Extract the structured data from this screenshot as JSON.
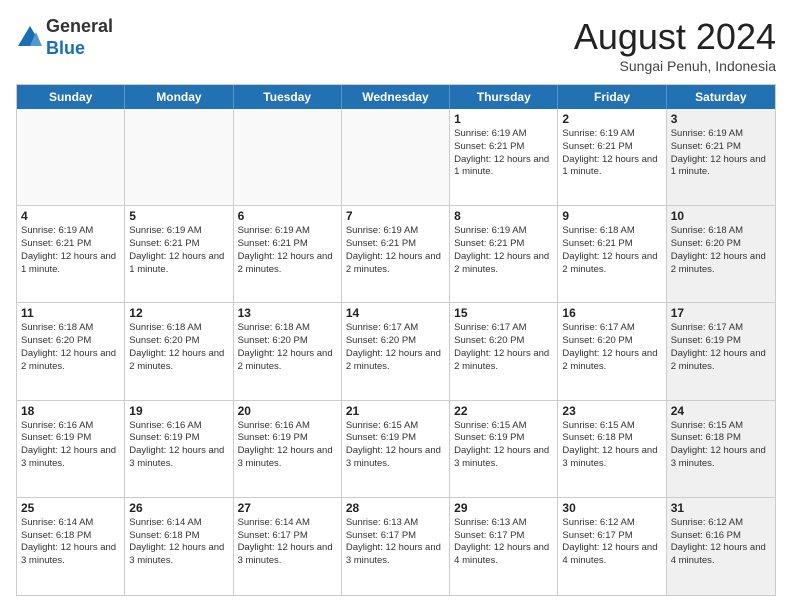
{
  "header": {
    "logo_line1": "General",
    "logo_line2": "Blue",
    "month": "August 2024",
    "location": "Sungai Penuh, Indonesia"
  },
  "weekdays": [
    "Sunday",
    "Monday",
    "Tuesday",
    "Wednesday",
    "Thursday",
    "Friday",
    "Saturday"
  ],
  "rows": [
    [
      {
        "day": "",
        "sunrise": "",
        "sunset": "",
        "daylight": "",
        "empty": true
      },
      {
        "day": "",
        "sunrise": "",
        "sunset": "",
        "daylight": "",
        "empty": true
      },
      {
        "day": "",
        "sunrise": "",
        "sunset": "",
        "daylight": "",
        "empty": true
      },
      {
        "day": "",
        "sunrise": "",
        "sunset": "",
        "daylight": "",
        "empty": true
      },
      {
        "day": "1",
        "sunrise": "Sunrise: 6:19 AM",
        "sunset": "Sunset: 6:21 PM",
        "daylight": "Daylight: 12 hours and 1 minute.",
        "empty": false
      },
      {
        "day": "2",
        "sunrise": "Sunrise: 6:19 AM",
        "sunset": "Sunset: 6:21 PM",
        "daylight": "Daylight: 12 hours and 1 minute.",
        "empty": false
      },
      {
        "day": "3",
        "sunrise": "Sunrise: 6:19 AM",
        "sunset": "Sunset: 6:21 PM",
        "daylight": "Daylight: 12 hours and 1 minute.",
        "empty": false,
        "shaded": true
      }
    ],
    [
      {
        "day": "4",
        "sunrise": "Sunrise: 6:19 AM",
        "sunset": "Sunset: 6:21 PM",
        "daylight": "Daylight: 12 hours and 1 minute.",
        "empty": false
      },
      {
        "day": "5",
        "sunrise": "Sunrise: 6:19 AM",
        "sunset": "Sunset: 6:21 PM",
        "daylight": "Daylight: 12 hours and 1 minute.",
        "empty": false
      },
      {
        "day": "6",
        "sunrise": "Sunrise: 6:19 AM",
        "sunset": "Sunset: 6:21 PM",
        "daylight": "Daylight: 12 hours and 2 minutes.",
        "empty": false
      },
      {
        "day": "7",
        "sunrise": "Sunrise: 6:19 AM",
        "sunset": "Sunset: 6:21 PM",
        "daylight": "Daylight: 12 hours and 2 minutes.",
        "empty": false
      },
      {
        "day": "8",
        "sunrise": "Sunrise: 6:19 AM",
        "sunset": "Sunset: 6:21 PM",
        "daylight": "Daylight: 12 hours and 2 minutes.",
        "empty": false
      },
      {
        "day": "9",
        "sunrise": "Sunrise: 6:18 AM",
        "sunset": "Sunset: 6:21 PM",
        "daylight": "Daylight: 12 hours and 2 minutes.",
        "empty": false
      },
      {
        "day": "10",
        "sunrise": "Sunrise: 6:18 AM",
        "sunset": "Sunset: 6:20 PM",
        "daylight": "Daylight: 12 hours and 2 minutes.",
        "empty": false,
        "shaded": true
      }
    ],
    [
      {
        "day": "11",
        "sunrise": "Sunrise: 6:18 AM",
        "sunset": "Sunset: 6:20 PM",
        "daylight": "Daylight: 12 hours and 2 minutes.",
        "empty": false
      },
      {
        "day": "12",
        "sunrise": "Sunrise: 6:18 AM",
        "sunset": "Sunset: 6:20 PM",
        "daylight": "Daylight: 12 hours and 2 minutes.",
        "empty": false
      },
      {
        "day": "13",
        "sunrise": "Sunrise: 6:18 AM",
        "sunset": "Sunset: 6:20 PM",
        "daylight": "Daylight: 12 hours and 2 minutes.",
        "empty": false
      },
      {
        "day": "14",
        "sunrise": "Sunrise: 6:17 AM",
        "sunset": "Sunset: 6:20 PM",
        "daylight": "Daylight: 12 hours and 2 minutes.",
        "empty": false
      },
      {
        "day": "15",
        "sunrise": "Sunrise: 6:17 AM",
        "sunset": "Sunset: 6:20 PM",
        "daylight": "Daylight: 12 hours and 2 minutes.",
        "empty": false
      },
      {
        "day": "16",
        "sunrise": "Sunrise: 6:17 AM",
        "sunset": "Sunset: 6:20 PM",
        "daylight": "Daylight: 12 hours and 2 minutes.",
        "empty": false
      },
      {
        "day": "17",
        "sunrise": "Sunrise: 6:17 AM",
        "sunset": "Sunset: 6:19 PM",
        "daylight": "Daylight: 12 hours and 2 minutes.",
        "empty": false,
        "shaded": true
      }
    ],
    [
      {
        "day": "18",
        "sunrise": "Sunrise: 6:16 AM",
        "sunset": "Sunset: 6:19 PM",
        "daylight": "Daylight: 12 hours and 3 minutes.",
        "empty": false
      },
      {
        "day": "19",
        "sunrise": "Sunrise: 6:16 AM",
        "sunset": "Sunset: 6:19 PM",
        "daylight": "Daylight: 12 hours and 3 minutes.",
        "empty": false
      },
      {
        "day": "20",
        "sunrise": "Sunrise: 6:16 AM",
        "sunset": "Sunset: 6:19 PM",
        "daylight": "Daylight: 12 hours and 3 minutes.",
        "empty": false
      },
      {
        "day": "21",
        "sunrise": "Sunrise: 6:15 AM",
        "sunset": "Sunset: 6:19 PM",
        "daylight": "Daylight: 12 hours and 3 minutes.",
        "empty": false
      },
      {
        "day": "22",
        "sunrise": "Sunrise: 6:15 AM",
        "sunset": "Sunset: 6:19 PM",
        "daylight": "Daylight: 12 hours and 3 minutes.",
        "empty": false
      },
      {
        "day": "23",
        "sunrise": "Sunrise: 6:15 AM",
        "sunset": "Sunset: 6:18 PM",
        "daylight": "Daylight: 12 hours and 3 minutes.",
        "empty": false
      },
      {
        "day": "24",
        "sunrise": "Sunrise: 6:15 AM",
        "sunset": "Sunset: 6:18 PM",
        "daylight": "Daylight: 12 hours and 3 minutes.",
        "empty": false,
        "shaded": true
      }
    ],
    [
      {
        "day": "25",
        "sunrise": "Sunrise: 6:14 AM",
        "sunset": "Sunset: 6:18 PM",
        "daylight": "Daylight: 12 hours and 3 minutes.",
        "empty": false
      },
      {
        "day": "26",
        "sunrise": "Sunrise: 6:14 AM",
        "sunset": "Sunset: 6:18 PM",
        "daylight": "Daylight: 12 hours and 3 minutes.",
        "empty": false
      },
      {
        "day": "27",
        "sunrise": "Sunrise: 6:14 AM",
        "sunset": "Sunset: 6:17 PM",
        "daylight": "Daylight: 12 hours and 3 minutes.",
        "empty": false
      },
      {
        "day": "28",
        "sunrise": "Sunrise: 6:13 AM",
        "sunset": "Sunset: 6:17 PM",
        "daylight": "Daylight: 12 hours and 3 minutes.",
        "empty": false
      },
      {
        "day": "29",
        "sunrise": "Sunrise: 6:13 AM",
        "sunset": "Sunset: 6:17 PM",
        "daylight": "Daylight: 12 hours and 4 minutes.",
        "empty": false
      },
      {
        "day": "30",
        "sunrise": "Sunrise: 6:12 AM",
        "sunset": "Sunset: 6:17 PM",
        "daylight": "Daylight: 12 hours and 4 minutes.",
        "empty": false
      },
      {
        "day": "31",
        "sunrise": "Sunrise: 6:12 AM",
        "sunset": "Sunset: 6:16 PM",
        "daylight": "Daylight: 12 hours and 4 minutes.",
        "empty": false,
        "shaded": true
      }
    ]
  ]
}
